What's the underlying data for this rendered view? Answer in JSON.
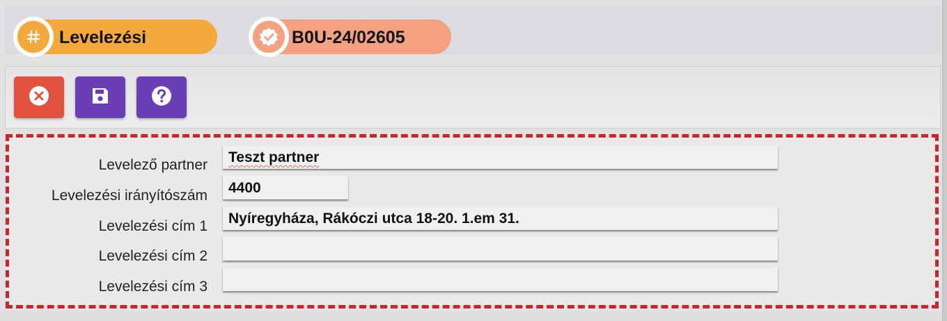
{
  "tags": [
    {
      "label": "Levelezési",
      "icon": "hash-icon",
      "color": "#f3a93b"
    },
    {
      "label": "B0U-24/02605",
      "icon": "verified-badge-icon",
      "color": "#f3a17f"
    }
  ],
  "toolbar": {
    "buttons": [
      {
        "icon": "close-circle-icon",
        "color": "#e2533f"
      },
      {
        "icon": "save-icon",
        "color": "#6a3fb5"
      },
      {
        "icon": "help-icon",
        "color": "#6a3fb5"
      }
    ]
  },
  "form": {
    "partner_label": "Levelező partner",
    "partner_value": "Teszt partner",
    "zip_label": "Levelezési irányítószám",
    "zip_value": "4400",
    "address1_label": "Levelezési cím 1",
    "address1_value": "Nyíregyháza, Rákóczi utca 18-20. 1.em 31.",
    "address2_label": "Levelezési cím 2",
    "address2_value": "",
    "address3_label": "Levelezési cím 3",
    "address3_value": ""
  }
}
